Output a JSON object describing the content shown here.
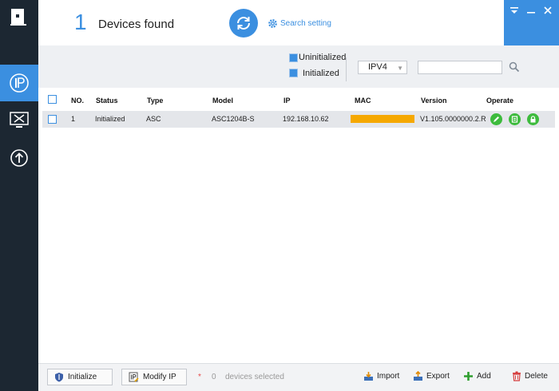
{
  "header": {
    "device_count": "1",
    "devices_found_label": "Devices found",
    "search_setting_label": "Search setting"
  },
  "filter": {
    "uninitialized_label": "Uninitialized",
    "initialized_label": "Initialized",
    "ip_version": "IPV4",
    "search_value": ""
  },
  "table": {
    "columns": [
      "NO.",
      "Status",
      "Type",
      "Model",
      "IP",
      "MAC",
      "Version",
      "Operate"
    ],
    "rows": [
      {
        "no": "1",
        "status": "Initialized",
        "type": "ASC",
        "model": "ASC1204B-S",
        "ip": "192.168.10.62",
        "version": "V1.105.0000000.2.R"
      }
    ]
  },
  "footer": {
    "initialize_label": "Initialize",
    "modify_ip_label": "Modify IP",
    "selected_star": "*",
    "selected_count": "0",
    "selected_label": "devices selected",
    "import_label": "Import",
    "export_label": "Export",
    "add_label": "Add",
    "delete_label": "Delete"
  },
  "colors": {
    "accent": "#3b8fe0",
    "sidebar": "#1c2732",
    "mac_redaction": "#f5a800",
    "operate_green": "#3dbb3d"
  }
}
